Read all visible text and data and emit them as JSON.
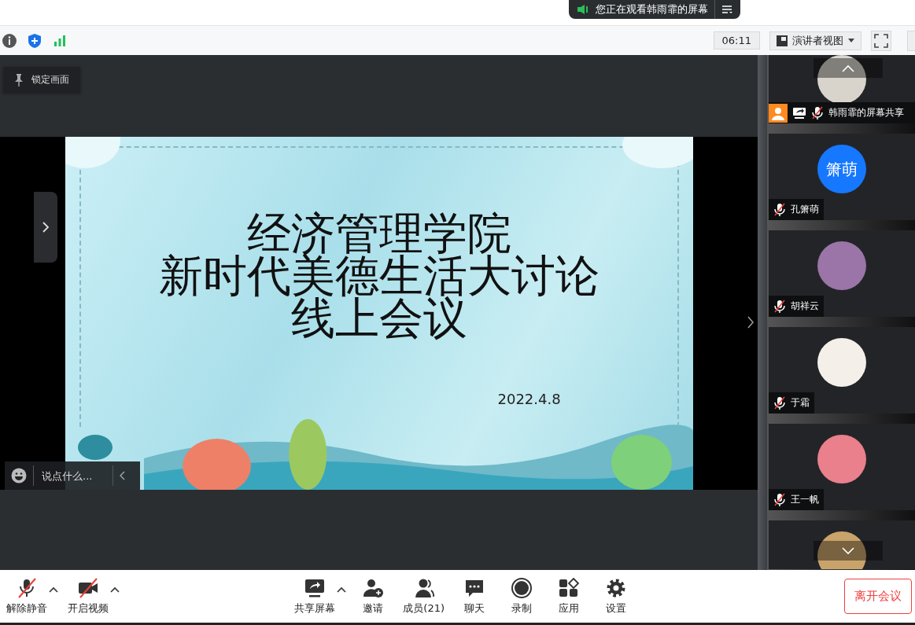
{
  "banner": {
    "text": "您正在观看韩雨霏的屏幕"
  },
  "toolbar": {
    "timer": "06:11",
    "view_button": "演讲者视图"
  },
  "lock_button": "锁定画面",
  "slide": {
    "lines": [
      "经济管理学院",
      "新时代美德生活大讨论",
      "线上会议"
    ],
    "date": "2022.4.8"
  },
  "chat_input": {
    "placeholder": "说点什么..."
  },
  "participants": [
    {
      "name": "韩雨霏的屏幕共享",
      "kind": "photo",
      "host": true,
      "sharing": true,
      "muted": true,
      "color": "#d8d4cc"
    },
    {
      "name": "孔箫萌",
      "kind": "initials",
      "initials": "箫萌",
      "host": false,
      "sharing": false,
      "muted": true,
      "color": "#1677ff"
    },
    {
      "name": "胡祥云",
      "kind": "photo",
      "host": false,
      "sharing": false,
      "muted": true,
      "color": "#9b74a8"
    },
    {
      "name": "于霜",
      "kind": "photo",
      "host": false,
      "sharing": false,
      "muted": true,
      "color": "#f4efe8"
    },
    {
      "name": "王一帆",
      "kind": "photo",
      "host": false,
      "sharing": false,
      "muted": true,
      "color": "#e9808c"
    },
    {
      "kind": "photo",
      "color": "#c9a46a"
    }
  ],
  "controls": [
    {
      "kind": "mic",
      "label": "解除静音",
      "off": true,
      "caret": true
    },
    {
      "kind": "video",
      "label": "开启视频",
      "off": true,
      "caret": true
    },
    {
      "kind": "spacer"
    },
    {
      "kind": "share",
      "label": "共享屏幕",
      "off": false,
      "caret": true
    },
    {
      "kind": "invite",
      "label": "邀请",
      "off": false,
      "caret": false
    },
    {
      "kind": "members",
      "label": "成员(21)",
      "off": false,
      "caret": false
    },
    {
      "kind": "chat",
      "label": "聊天",
      "off": false,
      "caret": false
    },
    {
      "kind": "record",
      "label": "录制",
      "off": false,
      "caret": false
    },
    {
      "kind": "apps",
      "label": "应用",
      "off": false,
      "caret": false
    },
    {
      "kind": "settings",
      "label": "设置",
      "off": false,
      "caret": false
    }
  ],
  "leave_button": "离开会议"
}
